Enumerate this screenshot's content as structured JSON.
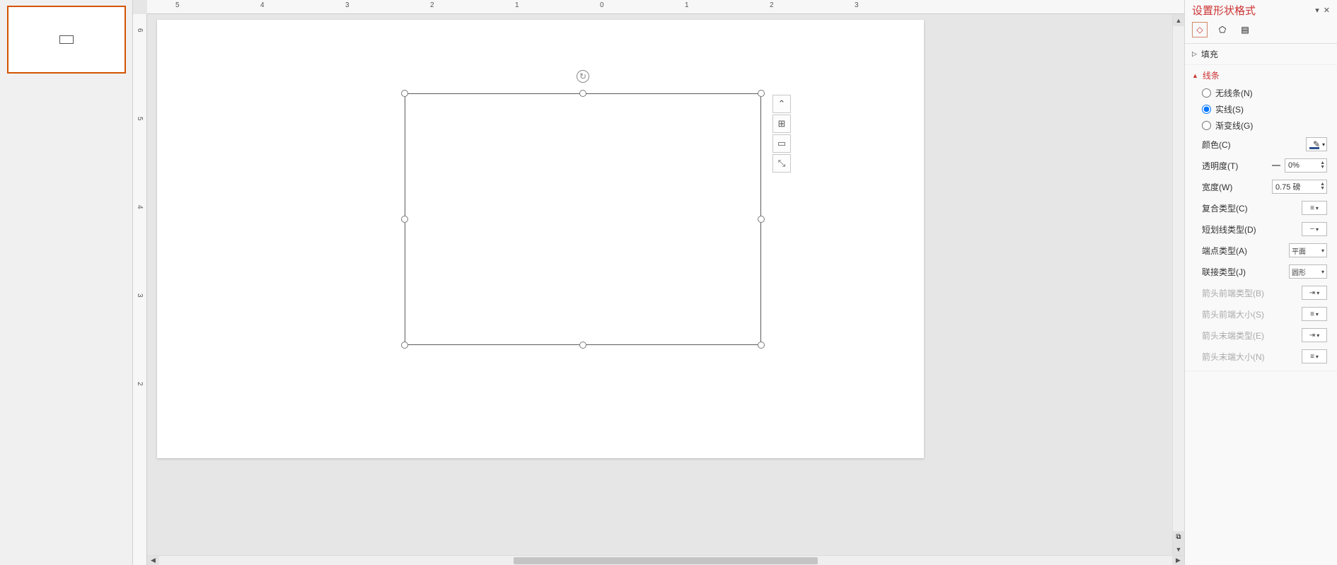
{
  "rulerH": [
    "5",
    "4",
    "3",
    "2",
    "1",
    "0",
    "1",
    "2",
    "3"
  ],
  "rulerV": [
    "6",
    "5",
    "4",
    "3",
    "2"
  ],
  "pane": {
    "title": "设置形状格式",
    "fill": {
      "label": "填充"
    },
    "line": {
      "label": "线条",
      "none": "无线条(N)",
      "solid": "实线(S)",
      "gradient": "渐变线(G)",
      "color": "颜色(C)",
      "transparency": "透明度(T)",
      "transparencyVal": "0%",
      "width": "宽度(W)",
      "widthVal": "0.75 磅",
      "compound": "复合类型(C)",
      "dash": "短划线类型(D)",
      "cap": "端点类型(A)",
      "capVal": "平面",
      "join": "联接类型(J)",
      "joinVal": "圆形",
      "beginType": "箭头前端类型(B)",
      "beginSize": "箭头前端大小(S)",
      "endType": "箭头末端类型(E)",
      "endSize": "箭头末端大小(N)"
    }
  }
}
